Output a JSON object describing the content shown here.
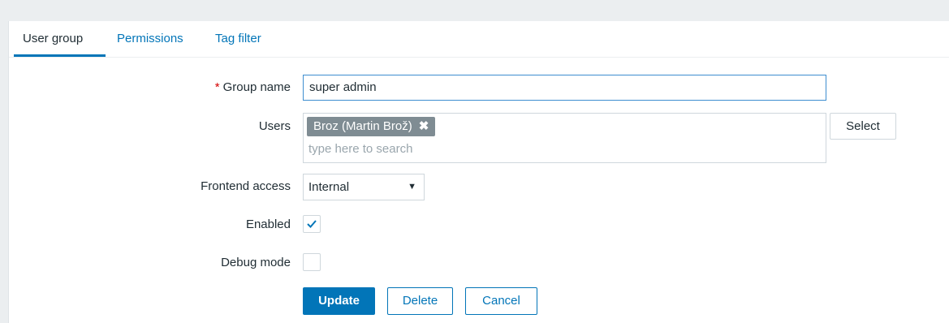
{
  "tabs": [
    {
      "label": "User group",
      "active": true
    },
    {
      "label": "Permissions",
      "active": false
    },
    {
      "label": "Tag filter",
      "active": false
    }
  ],
  "form": {
    "group_name": {
      "label": "Group name",
      "required_mark": "*",
      "value": "super admin"
    },
    "users": {
      "label": "Users",
      "selected": [
        {
          "label": "Broz (Martin Brož)",
          "remove_glyph": "✖"
        }
      ],
      "placeholder": "type here to search",
      "select_button": "Select"
    },
    "frontend_access": {
      "label": "Frontend access",
      "value": "Internal",
      "arrow": "▼"
    },
    "enabled": {
      "label": "Enabled",
      "checked": true
    },
    "debug_mode": {
      "label": "Debug mode",
      "checked": false
    }
  },
  "actions": {
    "update": "Update",
    "delete": "Delete",
    "cancel": "Cancel"
  },
  "colors": {
    "accent": "#0275b8",
    "required": "#d40000",
    "chip_bg": "#7f8c93",
    "page_bg": "#ebeef0"
  },
  "icons": {
    "checkmark": "check-icon",
    "remove": "close-icon",
    "dropdown": "chevron-down-icon"
  }
}
